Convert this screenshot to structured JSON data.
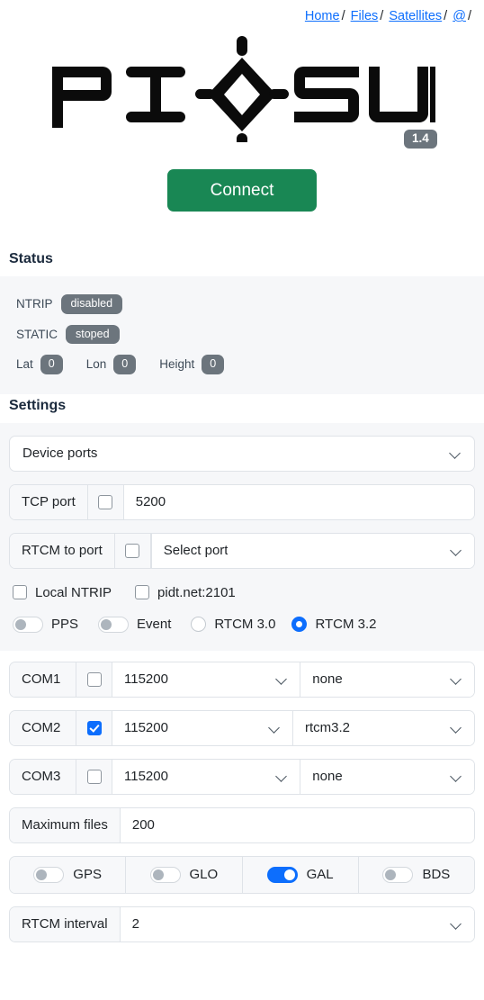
{
  "nav": {
    "items": [
      {
        "label": "Home"
      },
      {
        "label": "Files"
      },
      {
        "label": "Satellites"
      },
      {
        "label": "@"
      }
    ],
    "separator": "/"
  },
  "logo": {
    "text": "PI-◇-SUN",
    "version": "1.4"
  },
  "connect": {
    "label": "Connect",
    "color": "#198754"
  },
  "status": {
    "title": "Status",
    "ntrip": {
      "label": "NTRIP",
      "value": "disabled"
    },
    "static": {
      "label": "STATIC",
      "value": "stoped"
    },
    "coords": [
      {
        "label": "Lat",
        "value": "0"
      },
      {
        "label": "Lon",
        "value": "0"
      },
      {
        "label": "Height",
        "value": "0"
      }
    ]
  },
  "settings": {
    "title": "Settings",
    "device_ports": {
      "value": "Device ports"
    },
    "tcp_port": {
      "label": "TCP port",
      "checked": false,
      "value": "5200"
    },
    "rtcm_to_port": {
      "label": "RTCM to port",
      "checked": false,
      "value": "Select port"
    },
    "local_ntrip": {
      "label": "Local NTRIP",
      "checked": false
    },
    "ntrip_host": {
      "label": "pidt.net:2101",
      "checked": false
    },
    "pps": {
      "label": "PPS",
      "on": false
    },
    "event": {
      "label": "Event",
      "on": false
    },
    "rtcm30": {
      "label": "RTCM 3.0",
      "selected": false
    },
    "rtcm32": {
      "label": "RTCM 3.2",
      "selected": true
    },
    "ports": [
      {
        "name": "COM1",
        "checked": false,
        "baud": "115200",
        "protocol": "none"
      },
      {
        "name": "COM2",
        "checked": true,
        "baud": "115200",
        "protocol": "rtcm3.2"
      },
      {
        "name": "COM3",
        "checked": false,
        "baud": "115200",
        "protocol": "none"
      }
    ],
    "maximum_files": {
      "label": "Maximum files",
      "value": "200"
    },
    "gnss": [
      {
        "label": "GPS",
        "on": false
      },
      {
        "label": "GLO",
        "on": false
      },
      {
        "label": "GAL",
        "on": true
      },
      {
        "label": "BDS",
        "on": false
      }
    ],
    "rtcm_interval": {
      "label": "RTCM interval",
      "value": "2"
    }
  },
  "colors": {
    "accent_blue": "#0d6efd",
    "success_green": "#198754",
    "badge_gray": "#6c757d",
    "panel_bg": "#f6f7f9"
  }
}
